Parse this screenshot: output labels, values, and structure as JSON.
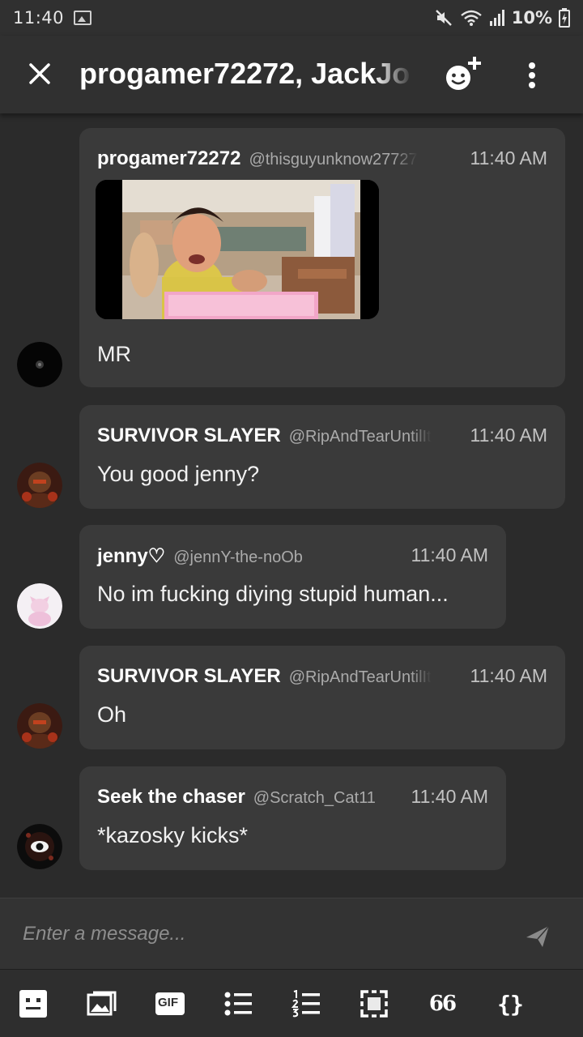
{
  "status_bar": {
    "time": "11:40",
    "battery": "10%"
  },
  "header": {
    "title": "progamer72272, JackJo"
  },
  "messages": [
    {
      "name": "progamer72272",
      "handle": "@thisguyunknow27727",
      "time": "11:40 AM",
      "text": "MR"
    },
    {
      "name": "SURVIVOR SLAYER",
      "handle": "@RipAndTearUntilIt",
      "time": "11:40 AM",
      "text": "You good jenny?"
    },
    {
      "name": "jenny♡",
      "handle": "@jennY-the-noOb",
      "time": "11:40 AM",
      "text": "No im fucking diying stupid human..."
    },
    {
      "name": "SURVIVOR SLAYER",
      "handle": "@RipAndTearUntilIt",
      "time": "11:40 AM",
      "text": "Oh"
    },
    {
      "name": "Seek the chaser",
      "handle": "@Scratch_Cat11",
      "time": "11:40 AM",
      "text": "*kazosky kicks*"
    }
  ],
  "composer": {
    "placeholder": "Enter a message..."
  },
  "toolbar": {
    "gif_label": "GIF",
    "quote_label": "66",
    "code_label": "{}"
  },
  "colors": {
    "background": "#2b2b2b",
    "bubble": "#3a3a3a",
    "bar": "#303030"
  }
}
